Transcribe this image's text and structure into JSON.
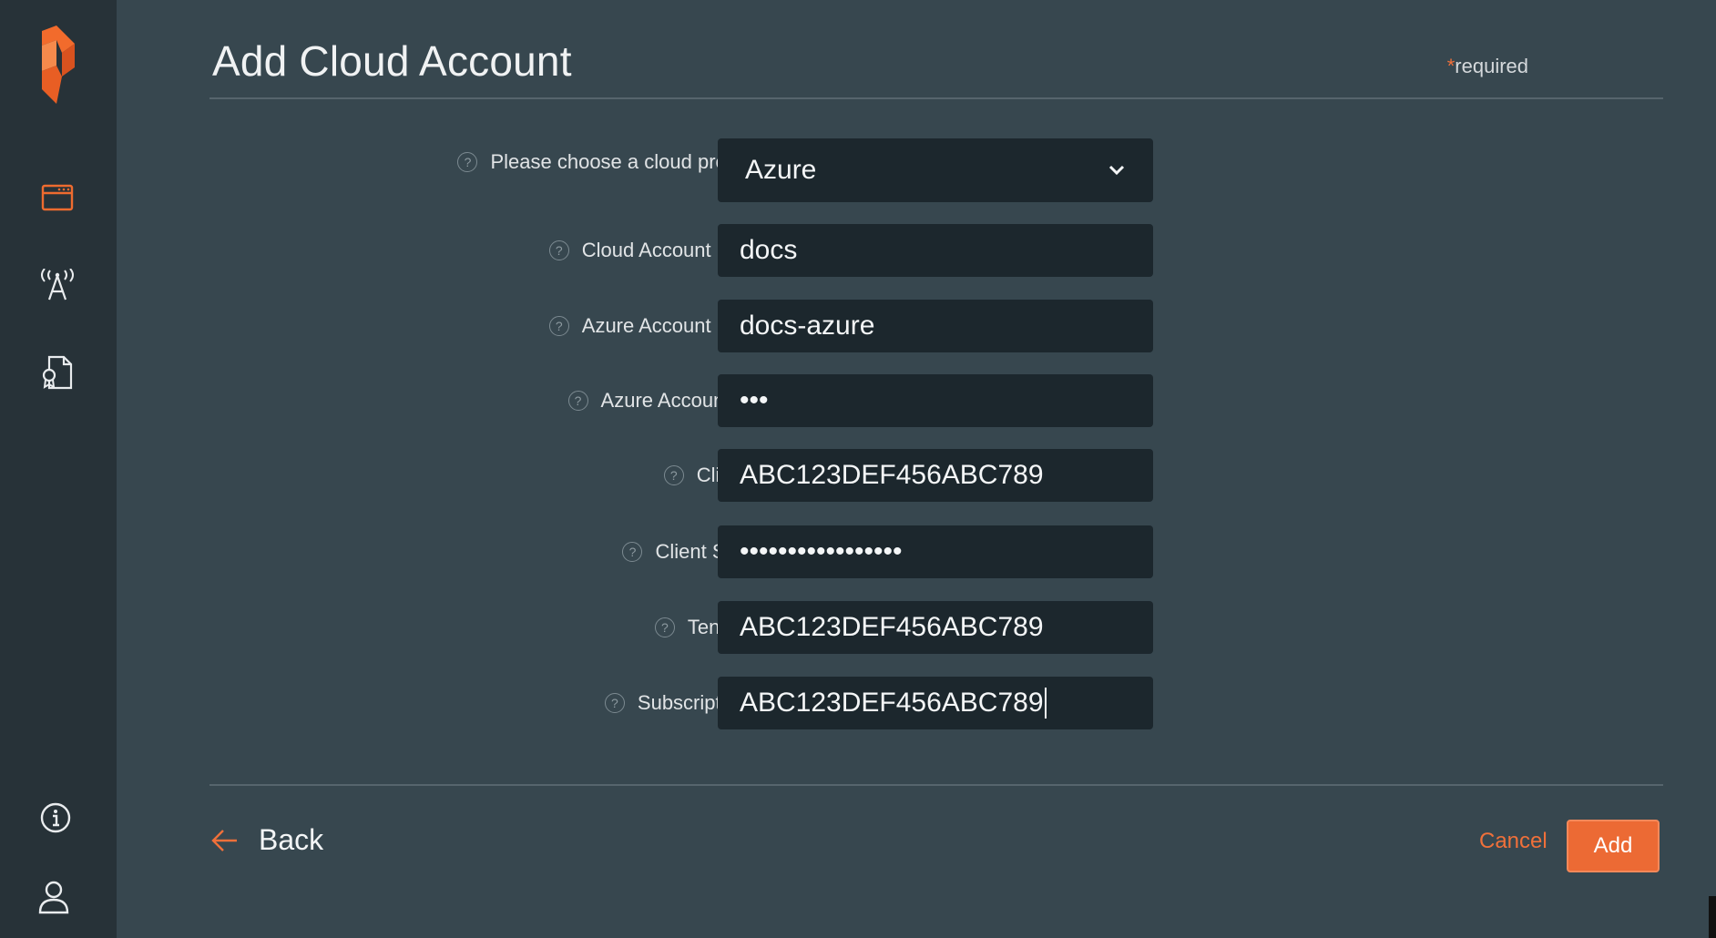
{
  "page": {
    "title": "Add Cloud Account",
    "required_star": "*",
    "required_text": "required"
  },
  "sidebar": {
    "items": [
      {
        "name": "logo",
        "icon": "portworx-logo-icon"
      },
      {
        "name": "clusters",
        "icon": "window-icon"
      },
      {
        "name": "monitoring",
        "icon": "antenna-icon"
      },
      {
        "name": "licenses",
        "icon": "certificate-icon"
      },
      {
        "name": "info",
        "icon": "info-icon"
      },
      {
        "name": "user",
        "icon": "user-icon"
      }
    ]
  },
  "form": {
    "provider": {
      "label": "Please choose a cloud provider",
      "value": "Azure",
      "star": "*"
    },
    "cloud_account_name": {
      "label": "Cloud Account Name",
      "value": "docs",
      "star": "*"
    },
    "azure_account_name": {
      "label": "Azure Account Name",
      "value": "docs-azure",
      "star": "*"
    },
    "azure_account_key": {
      "label": "Azure Account Key",
      "value": "•••",
      "star": "*"
    },
    "client_id": {
      "label": "Client Id",
      "value": "ABC123DEF456ABC789",
      "star": "*"
    },
    "client_secret": {
      "label": "Client Secret",
      "value": "•••••••••••••••••",
      "star": "*"
    },
    "tenant_id": {
      "label": "Tenant Id",
      "value": "ABC123DEF456ABC789",
      "star": "*"
    },
    "subscription_id": {
      "label": "Subscription Id",
      "value": "ABC123DEF456ABC789",
      "star": "*"
    },
    "help_glyph": "?"
  },
  "footer": {
    "back_label": "Back",
    "cancel_label": "Cancel",
    "add_label": "Add"
  },
  "colors": {
    "accent": "#f0703a",
    "background": "#37474f",
    "sidebar": "#273238",
    "field": "#1c272d"
  }
}
